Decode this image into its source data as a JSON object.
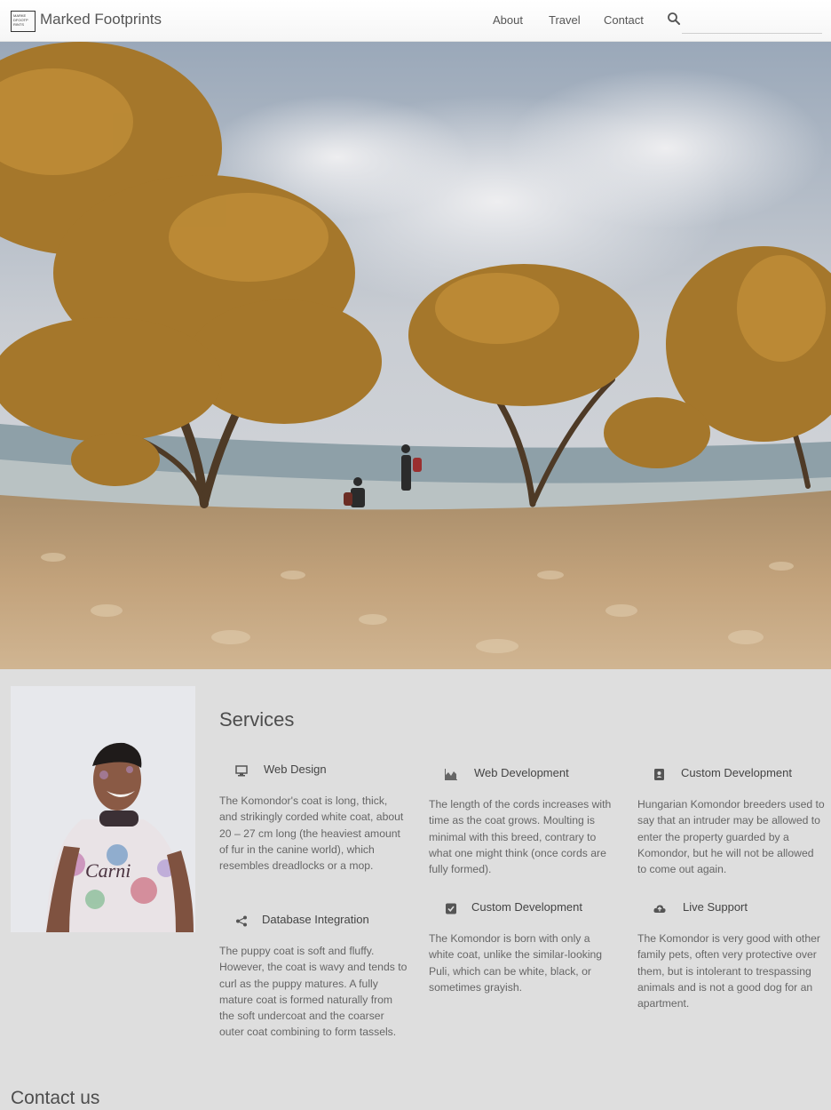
{
  "header": {
    "logo_text": "MARKE DFOOTP RINTS",
    "brand": "Marked Footprints",
    "nav": [
      "About",
      "Travel",
      "Contact"
    ],
    "search_placeholder": ""
  },
  "hero": {
    "image": "beach-mangrove-trees-photo"
  },
  "about": {
    "image": "portrait-photo"
  },
  "services": {
    "title": "Services",
    "items": [
      {
        "icon": "monitor-icon",
        "title": "Web Design",
        "description": "The Komondor's coat is long, thick, and strikingly corded white coat, about 20 – 27 cm long (the heaviest amount of fur in the canine world), which resembles dreadlocks or a mop."
      },
      {
        "icon": "area-chart-icon",
        "title": "Web Development",
        "description": "The length of the cords increases with time as the coat grows. Moulting is minimal with this breed, contrary to what one might think (once cords are fully formed)."
      },
      {
        "icon": "address-book-icon",
        "title": "Custom Development",
        "description": "Hungarian Komondor breeders used to say that an intruder may be allowed to enter the property guarded by a Komondor, but he will not be allowed to come out again."
      },
      {
        "icon": "share-icon",
        "title": "Database Integration",
        "description": "The puppy coat is soft and fluffy. However, the coat is wavy and tends to curl as the puppy matures. A fully mature coat is formed naturally from the soft undercoat and the coarser outer coat combining to form tassels."
      },
      {
        "icon": "check-square-icon",
        "title": "Custom Development",
        "description": "The Komondor is born with only a white coat, unlike the similar-looking Puli, which can be white, black, or sometimes grayish."
      },
      {
        "icon": "cloud-upload-icon",
        "title": "Live Support",
        "description": "The Komondor is very good with other family pets, often very protective over them, but is intolerant to trespassing animals and is not a good dog for an apartment."
      }
    ]
  },
  "contact": {
    "title": "Contact us"
  }
}
